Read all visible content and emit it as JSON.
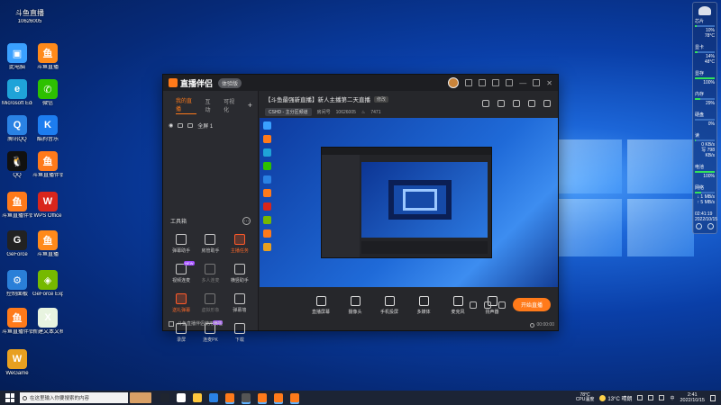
{
  "desktop": {
    "icons": [
      {
        "label": "此电脑",
        "color": "#3aa0ff",
        "glyph": "▣"
      },
      {
        "label": "斗鱼直播",
        "color": "#ff8a1a",
        "glyph": "鱼"
      },
      {
        "label": "Microsoft Edge",
        "color": "#1fa3d8",
        "glyph": "e"
      },
      {
        "label": "微信",
        "color": "#2dc100",
        "glyph": "✆"
      },
      {
        "label": "腾讯QQ",
        "color": "#2a82e4",
        "glyph": "Q"
      },
      {
        "label": "酷狗音乐",
        "color": "#1d7df0",
        "glyph": "K"
      },
      {
        "label": "QQ",
        "color": "#111111",
        "glyph": "🐧"
      },
      {
        "label": "斗鱼直播伴侣",
        "color": "#ff7a1a",
        "glyph": "鱼"
      },
      {
        "label": "斗鱼直播伴侣",
        "color": "#ff7a1a",
        "glyph": "鱼"
      },
      {
        "label": "WPS Office",
        "color": "#d9261c",
        "glyph": "W"
      },
      {
        "label": "GeForce",
        "color": "#222222",
        "glyph": "G"
      },
      {
        "label": "斗鱼直播",
        "color": "#ff8a1a",
        "glyph": "鱼"
      },
      {
        "label": "控制面板",
        "color": "#2a7fd8",
        "glyph": "⚙"
      },
      {
        "label": "GeForce Experience",
        "color": "#76b900",
        "glyph": "◈"
      },
      {
        "label": "斗鱼直播伴侣",
        "color": "#ff7a1a",
        "glyph": "鱼"
      },
      {
        "label": "新建文本文档",
        "color": "#e8f4e0",
        "glyph": "X"
      },
      {
        "label": "WeGame",
        "color": "#e8a020",
        "glyph": "W"
      }
    ],
    "top_app": {
      "label": "斗鱼直播",
      "id_text": "10626005"
    }
  },
  "app": {
    "title": "直播伴侣",
    "version_badge": "体验版",
    "left_tabs": [
      "我的直播",
      "互动",
      "可视化"
    ],
    "scene": "全屏 1",
    "toolbox_title": "工具箱",
    "tools": [
      {
        "label": "弹幕助手",
        "state": "normal"
      },
      {
        "label": "房管助手",
        "state": "normal"
      },
      {
        "label": "主播任务",
        "state": "hot"
      },
      {
        "label": "视频连麦",
        "state": "normal",
        "badge": "NEW"
      },
      {
        "label": "多人连麦",
        "state": "dim"
      },
      {
        "label": "横竖助手",
        "state": "normal"
      },
      {
        "label": "送礼弹幕",
        "state": "hot"
      },
      {
        "label": "虚拟形象",
        "state": "dim"
      },
      {
        "label": "弹幕墙",
        "state": "normal"
      },
      {
        "label": "录屏",
        "state": "normal"
      },
      {
        "label": "连麦PK",
        "state": "normal",
        "badge": "HOT"
      },
      {
        "label": "下载",
        "state": "normal"
      }
    ],
    "notice": "斗鱼直播伴侣使用教程",
    "room": {
      "title": "【斗鱼最强新直播】新人主播第二天直播",
      "tag": "修改",
      "category": "CSHD - 主分区频道",
      "room_id_label": "房间号",
      "room_id": "10626005",
      "fans": "7471"
    },
    "controls": [
      "直播屏幕",
      "摄像头",
      "手机投屏",
      "多媒体",
      "麦克风",
      "扬声器"
    ],
    "go_live": "开始直播",
    "timer": "00:00:00"
  },
  "monitor": {
    "rows": [
      {
        "label": "芯片",
        "value": "10%",
        "extra": "78°C",
        "level": 0.1
      },
      {
        "label": "显卡",
        "value": "14%",
        "extra": "48°C",
        "level": 0.14
      },
      {
        "label": "显存",
        "value": "100%",
        "extra": "",
        "level": 1.0
      },
      {
        "label": "内存",
        "value": "29%",
        "extra": "",
        "level": 0.29
      },
      {
        "label": "硬盘",
        "value": "0%",
        "extra": "",
        "level": 0.0
      },
      {
        "label": "读",
        "value": "0 KB/s",
        "extra": "写 798 KB/s",
        "level": 0.05
      },
      {
        "label": "电池",
        "value": "100%",
        "extra": "",
        "level": 1.0
      },
      {
        "label": "网络",
        "value": "↓ 1 MB/s",
        "extra": "↑ 5 MB/s",
        "level": 0.3
      }
    ],
    "time": "02:41:19",
    "date": "2022/10/15"
  },
  "taskbar": {
    "search_placeholder": "在这里输入你要搜索的内容",
    "apps": [
      "#1f2530",
      "#ffffff",
      "#ffc83d",
      "#2a82e4",
      "#ff7a1a",
      "#555555",
      "#ff7a1a",
      "#ff7a1a",
      "#ff7a1a"
    ],
    "cpu_temp": "78°C",
    "cpu_label": "CPU温度",
    "weather": "13°C 晴朗",
    "time": "2:41",
    "date": "2022/10/15"
  }
}
